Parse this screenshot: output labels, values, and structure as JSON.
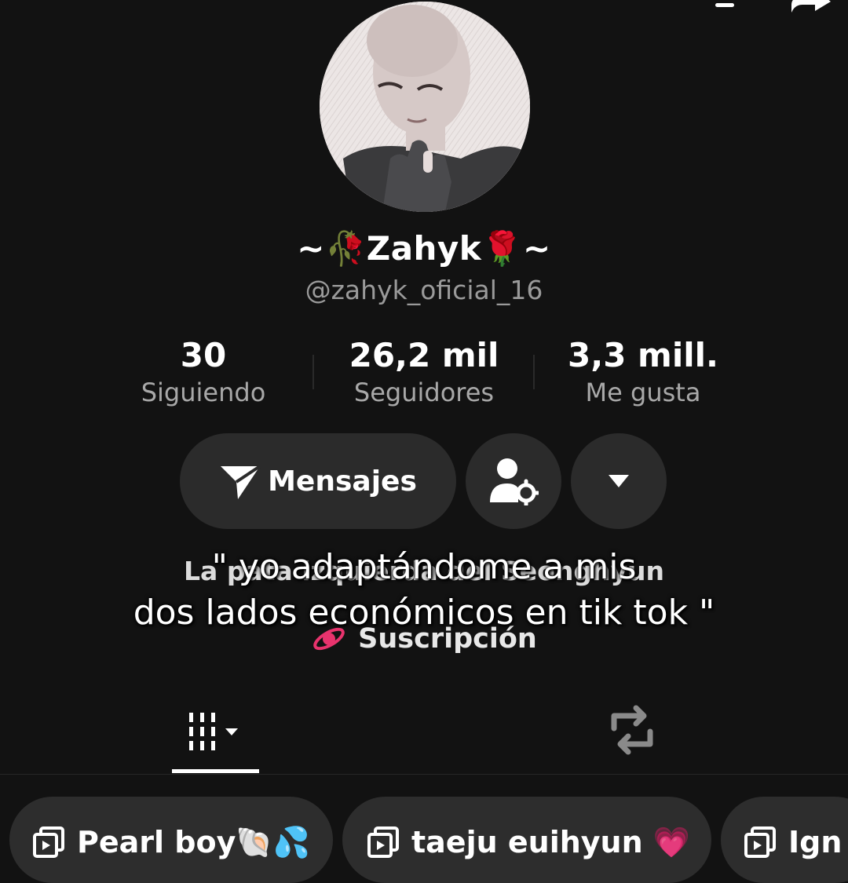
{
  "profile": {
    "display_name": "~🥀Zahyk🌹~",
    "handle": "@zahyk_oficial_16"
  },
  "stats": {
    "following": {
      "value": "30",
      "label": "Siguiendo"
    },
    "followers": {
      "value": "26,2 mil",
      "label": "Seguidores"
    },
    "likes": {
      "value": "3,3 mill.",
      "label": "Me gusta"
    }
  },
  "actions": {
    "message_label": "Mensajes",
    "icons": {
      "message": "send-icon",
      "friend": "add-friend-settings-icon",
      "more": "caret-down-icon"
    }
  },
  "bio": {
    "text": "La pata izquierda del Seonghyun",
    "subscription_label": "Suscripción"
  },
  "caption": {
    "line1": "\" yo adaptándome a mis",
    "line2": "dos lados económicos en tik tok \""
  },
  "tabs": {
    "videos_icon": "grid-icon",
    "reposts_icon": "repost-icon"
  },
  "playlists": [
    {
      "label": "Pearl boy🐚💦"
    },
    {
      "label": "taeju euihyun 💗"
    },
    {
      "label": "Ign"
    }
  ],
  "colors": {
    "background": "#121212",
    "button": "#2b2b2b",
    "accent_pink": "#e8336d"
  }
}
